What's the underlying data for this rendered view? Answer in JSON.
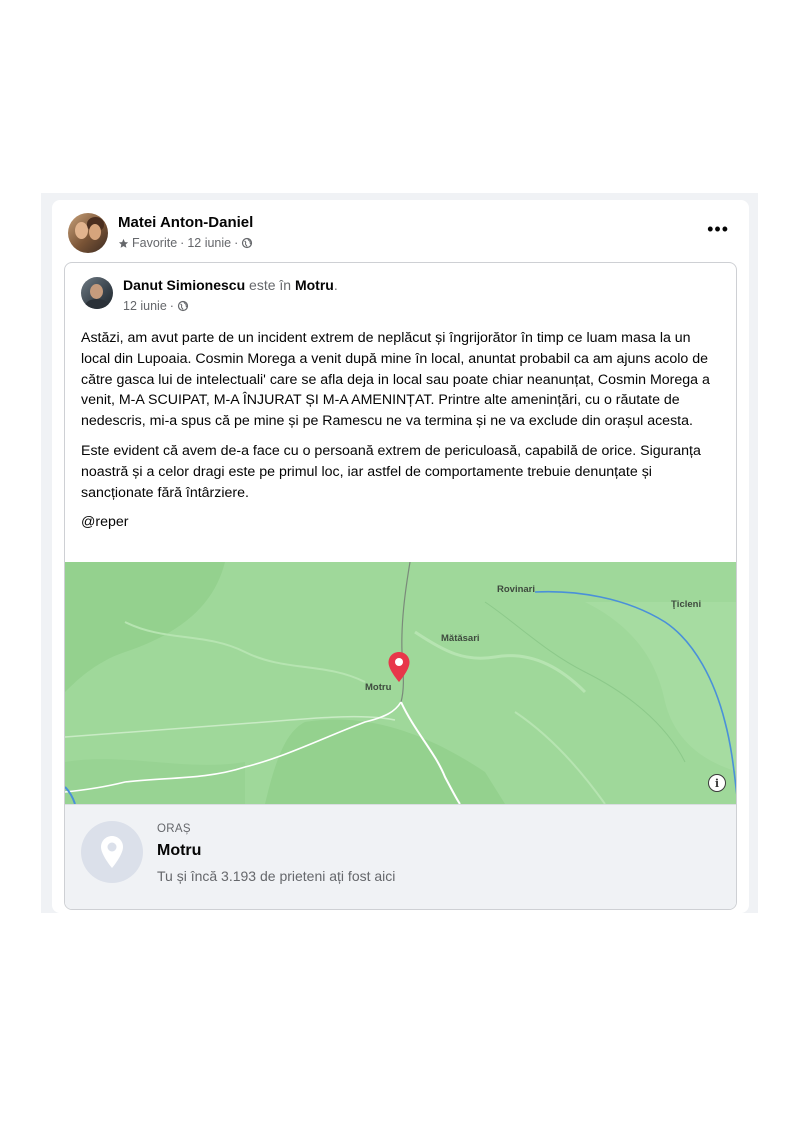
{
  "post": {
    "author": "Matei Anton-Daniel",
    "audience": "Favorite",
    "date": "12 iunie",
    "more_label": "•••"
  },
  "shared": {
    "author": "Danut Simionescu",
    "connector": "este în",
    "location": "Motru",
    "period": ".",
    "date": "12 iunie",
    "paragraphs": [
      "Astăzi, am avut parte de un incident extrem de neplăcut și îngrijorător în timp ce luam masa la un local din Lupoaia. Cosmin Morega a venit după mine în local, anuntat probabil ca am ajuns acolo de către gasca lui de intelectuali' care se afla deja in local sau poate chiar neanunțat, Cosmin Morega a venit, M-A SCUIPAT, M-A ÎNJURAT ȘI M-A AMENINȚAT.  Printre alte amenințări, cu o răutate de nedescris, mi-a spus că pe mine și pe Ramescu ne va termina și ne va exclude din orașul acesta.",
      "Este evident că avem de-a face cu o persoană extrem de periculoasă, capabilă de orice. Siguranța noastră și a celor dragi este pe primul loc, iar astfel de comportamente trebuie denunțate și sancționate fără întârziere.",
      "@reper"
    ]
  },
  "map": {
    "labels": {
      "rovinari": "Rovinari",
      "ticleni": "Ţicleni",
      "matasari": "Mătăsari",
      "motru": "Motru"
    },
    "pin_color": "#e8374a",
    "base_color": "#9fd89a",
    "river_color": "#4a90d9"
  },
  "place": {
    "type": "ORAȘ",
    "name": "Motru",
    "subtitle": "Tu și încă 3.193 de prieteni ați fost aici"
  }
}
